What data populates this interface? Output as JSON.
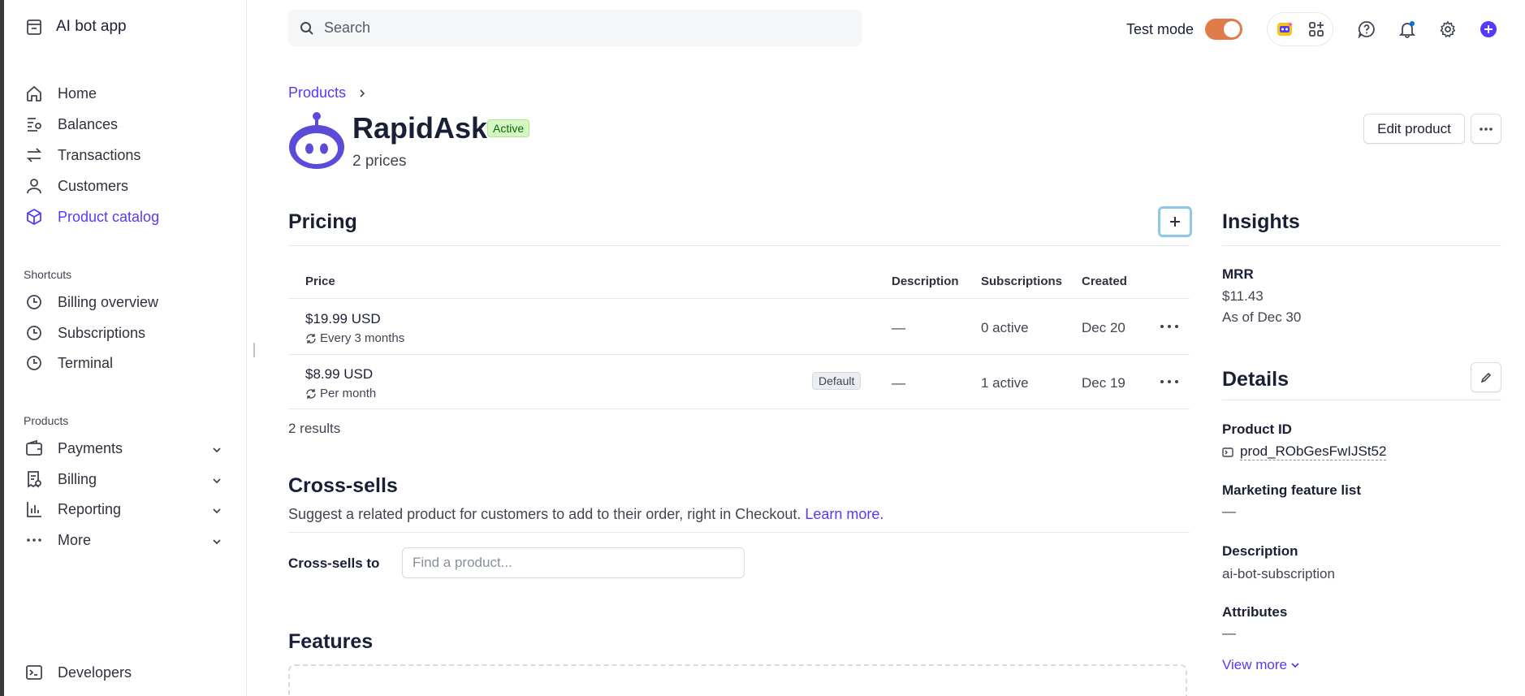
{
  "sidebar": {
    "brand": "AI bot app",
    "nav": [
      {
        "label": "Home",
        "icon": "home-icon"
      },
      {
        "label": "Balances",
        "icon": "balances-icon"
      },
      {
        "label": "Transactions",
        "icon": "transactions-icon"
      },
      {
        "label": "Customers",
        "icon": "customers-icon"
      },
      {
        "label": "Product catalog",
        "icon": "product-catalog-icon",
        "active": true
      }
    ],
    "shortcuts_title": "Shortcuts",
    "shortcuts": [
      {
        "label": "Billing overview",
        "icon": "clock-icon"
      },
      {
        "label": "Subscriptions",
        "icon": "clock-icon"
      },
      {
        "label": "Terminal",
        "icon": "clock-icon"
      }
    ],
    "products_title": "Products",
    "products": [
      {
        "label": "Payments",
        "icon": "wallet-icon"
      },
      {
        "label": "Billing",
        "icon": "billing-icon"
      },
      {
        "label": "Reporting",
        "icon": "reporting-icon"
      },
      {
        "label": "More",
        "icon": "more-icon"
      }
    ],
    "developers": "Developers"
  },
  "topbar": {
    "search_placeholder": "Search",
    "test_mode_label": "Test mode",
    "test_mode_on": true
  },
  "breadcrumb": {
    "parent": "Products"
  },
  "product": {
    "name": "RapidAsk",
    "status": "Active",
    "prices_count": "2 prices",
    "edit_button": "Edit product"
  },
  "pricing": {
    "title": "Pricing",
    "columns": [
      "Price",
      "Description",
      "Subscriptions",
      "Created"
    ],
    "rows": [
      {
        "amount": "$19.99 USD",
        "interval": "Every 3 months",
        "badge": "",
        "description": "—",
        "subscriptions": "0 active",
        "created": "Dec 20"
      },
      {
        "amount": "$8.99 USD",
        "interval": "Per month",
        "badge": "Default",
        "description": "—",
        "subscriptions": "1 active",
        "created": "Dec 19"
      }
    ],
    "results": "2 results"
  },
  "cross_sells": {
    "title": "Cross-sells",
    "subtitle": "Suggest a related product for customers to add to their order, right in Checkout.",
    "learn_more": "Learn more.",
    "label": "Cross-sells to",
    "placeholder": "Find a product..."
  },
  "features": {
    "title": "Features"
  },
  "insights": {
    "title": "Insights",
    "mrr_label": "MRR",
    "mrr_value": "$11.43",
    "mrr_asof": "As of Dec 30"
  },
  "details": {
    "title": "Details",
    "product_id_label": "Product ID",
    "product_id": "prod_RObGesFwIJSt52",
    "marketing_label": "Marketing feature list",
    "marketing_value": "—",
    "description_label": "Description",
    "description_value": "ai-bot-subscription",
    "attributes_label": "Attributes",
    "attributes_value": "—",
    "view_more": "View more"
  },
  "colors": {
    "accent": "#533afd",
    "toggle": "#df7c4a",
    "active_badge_bg": "#d7f7c2"
  }
}
